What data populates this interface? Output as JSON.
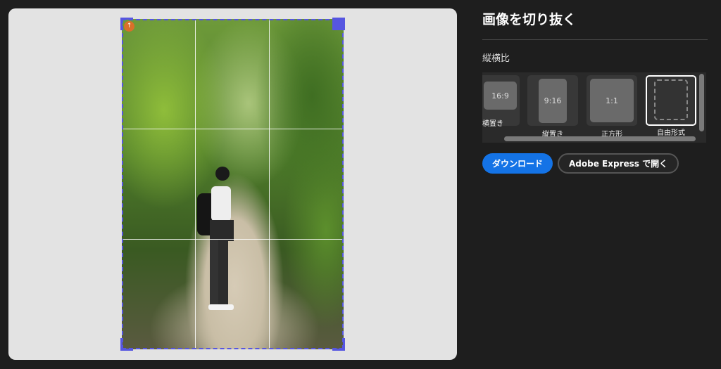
{
  "panel": {
    "title": "画像を切り抜く",
    "aspect_label": "縦横比",
    "options": [
      {
        "ratio": "16:9",
        "label": "横置き"
      },
      {
        "ratio": "9:16",
        "label": "縦置き"
      },
      {
        "ratio": "1:1",
        "label": "正方形"
      },
      {
        "ratio": "",
        "label": "自由形式",
        "selected": true
      }
    ],
    "download": "ダウンロード",
    "open_express": "Adobe Express で開く"
  },
  "colors": {
    "accent": "#1473e6",
    "crop_frame": "#5656e0"
  },
  "icons": [
    "upload-badge-icon",
    "resize-handle-icon"
  ]
}
